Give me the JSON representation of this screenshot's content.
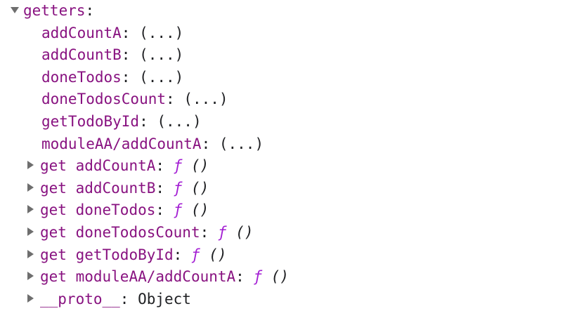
{
  "root": {
    "key": "getters",
    "colon": ":"
  },
  "children": [
    {
      "key": "addCountA",
      "value": "(...)"
    },
    {
      "key": "addCountB",
      "value": "(...)"
    },
    {
      "key": "doneTodos",
      "value": "(...)"
    },
    {
      "key": "doneTodosCount",
      "value": "(...)"
    },
    {
      "key": "getTodoById",
      "value": "(...)"
    },
    {
      "key": "moduleAA/addCountA",
      "value": "(...)"
    }
  ],
  "getters": [
    {
      "prefix": "get",
      "key": "addCountA",
      "f": "ƒ",
      "parens": "()"
    },
    {
      "prefix": "get",
      "key": "addCountB",
      "f": "ƒ",
      "parens": "()"
    },
    {
      "prefix": "get",
      "key": "doneTodos",
      "f": "ƒ",
      "parens": "()"
    },
    {
      "prefix": "get",
      "key": "doneTodosCount",
      "f": "ƒ",
      "parens": "()"
    },
    {
      "prefix": "get",
      "key": "getTodoById",
      "f": "ƒ",
      "parens": "()"
    },
    {
      "prefix": "get",
      "key": "moduleAA/addCountA",
      "f": "ƒ",
      "parens": "()"
    }
  ],
  "proto": {
    "key": "__proto__",
    "value": "Object"
  },
  "colors": {
    "key": "#881280",
    "function_f": "#a31ed3",
    "text": "#202124",
    "triangle": "#6e6e6e"
  },
  "icons": {
    "expanded": "triangle-down-icon",
    "collapsed": "triangle-right-icon"
  }
}
